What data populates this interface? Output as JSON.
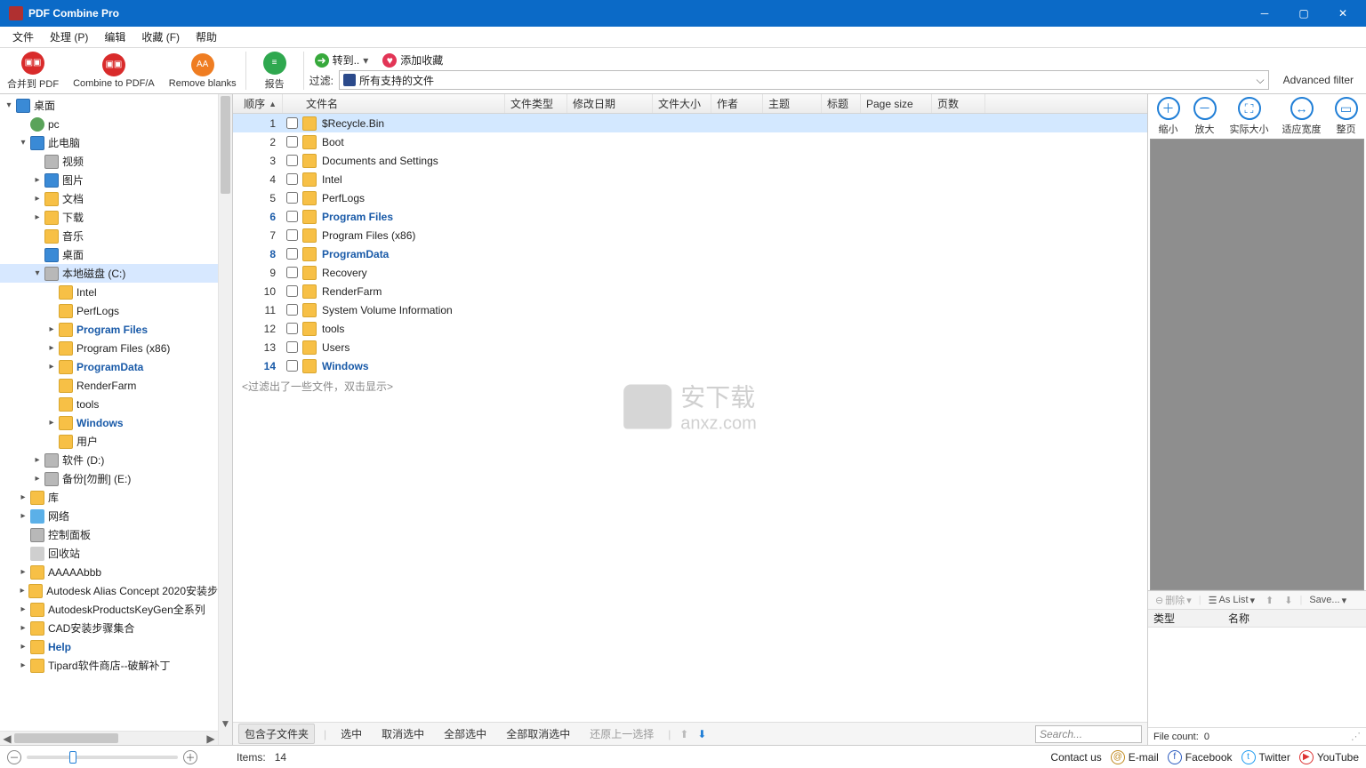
{
  "window": {
    "title": "PDF Combine Pro"
  },
  "menu": [
    "文件",
    "处理 (P)",
    "编辑",
    "收藏 (F)",
    "帮助"
  ],
  "toolbar": {
    "combine_pdf": "合并到 PDF",
    "combine_pdfa": "Combine to PDF/A",
    "remove_blanks": "Remove blanks",
    "report": "报告",
    "goto": "转到..",
    "add_fav": "添加收藏",
    "filter_label": "过滤:",
    "filter_value": "所有支持的文件",
    "adv_filter": "Advanced filter"
  },
  "tree": [
    {
      "d": 0,
      "c": "down",
      "ico": "nscreen",
      "t": "桌面"
    },
    {
      "d": 1,
      "c": "blank",
      "ico": "nuser",
      "t": "pc"
    },
    {
      "d": 1,
      "c": "down",
      "ico": "nscreen",
      "t": "此电脑"
    },
    {
      "d": 2,
      "c": "blank",
      "ico": "ndisk",
      "t": "视频"
    },
    {
      "d": 2,
      "c": "right",
      "ico": "nscreen",
      "t": "图片"
    },
    {
      "d": 2,
      "c": "right",
      "ico": "nfolder",
      "t": "文档"
    },
    {
      "d": 2,
      "c": "right",
      "ico": "nfolder",
      "t": "下载"
    },
    {
      "d": 2,
      "c": "blank",
      "ico": "nfolder",
      "t": "音乐"
    },
    {
      "d": 2,
      "c": "blank",
      "ico": "nscreen",
      "t": "桌面"
    },
    {
      "d": 2,
      "c": "down",
      "ico": "ndisk",
      "t": "本地磁盘 (C:)",
      "sel": true
    },
    {
      "d": 3,
      "c": "blank",
      "ico": "nfolder",
      "t": "Intel"
    },
    {
      "d": 3,
      "c": "blank",
      "ico": "nfolder",
      "t": "PerfLogs"
    },
    {
      "d": 3,
      "c": "right",
      "ico": "nfolder",
      "t": "Program Files",
      "b": true
    },
    {
      "d": 3,
      "c": "right",
      "ico": "nfolder",
      "t": "Program Files (x86)"
    },
    {
      "d": 3,
      "c": "right",
      "ico": "nfolder",
      "t": "ProgramData",
      "b": true
    },
    {
      "d": 3,
      "c": "blank",
      "ico": "nfolder",
      "t": "RenderFarm"
    },
    {
      "d": 3,
      "c": "blank",
      "ico": "nfolder",
      "t": "tools"
    },
    {
      "d": 3,
      "c": "right",
      "ico": "nfolder",
      "t": "Windows",
      "b": true
    },
    {
      "d": 3,
      "c": "blank",
      "ico": "nfolder",
      "t": "用户"
    },
    {
      "d": 2,
      "c": "right",
      "ico": "ndisk",
      "t": "软件 (D:)"
    },
    {
      "d": 2,
      "c": "right",
      "ico": "ndisk",
      "t": "备份[勿删] (E:)"
    },
    {
      "d": 1,
      "c": "right",
      "ico": "nfolder",
      "t": "库"
    },
    {
      "d": 1,
      "c": "right",
      "ico": "nnet",
      "t": "网络"
    },
    {
      "d": 1,
      "c": "blank",
      "ico": "ndisk",
      "t": "控制面板"
    },
    {
      "d": 1,
      "c": "blank",
      "ico": "nbin",
      "t": "回收站"
    },
    {
      "d": 1,
      "c": "right",
      "ico": "nfolder",
      "t": "AAAAAbbb"
    },
    {
      "d": 1,
      "c": "right",
      "ico": "nfolder",
      "t": "Autodesk Alias Concept 2020安装步"
    },
    {
      "d": 1,
      "c": "right",
      "ico": "nfolder",
      "t": "AutodeskProductsKeyGen全系列"
    },
    {
      "d": 1,
      "c": "right",
      "ico": "nfolder",
      "t": "CAD安装步骤集合"
    },
    {
      "d": 1,
      "c": "right",
      "ico": "nfolder",
      "t": "Help",
      "b": true
    },
    {
      "d": 1,
      "c": "right",
      "ico": "nfolder",
      "t": "Tipard软件商店--破解补丁"
    }
  ],
  "columns": {
    "seq": "顺序",
    "name": "文件名",
    "type": "文件类型",
    "date": "修改日期",
    "size": "文件大小",
    "author": "作者",
    "subject": "主题",
    "title": "标题",
    "pagesize": "Page size",
    "pages": "页数"
  },
  "files": [
    {
      "n": 1,
      "name": "$Recycle.Bin",
      "sel": true
    },
    {
      "n": 2,
      "name": "Boot"
    },
    {
      "n": 3,
      "name": "Documents and Settings"
    },
    {
      "n": 4,
      "name": "Intel"
    },
    {
      "n": 5,
      "name": "PerfLogs"
    },
    {
      "n": 6,
      "name": "Program Files",
      "b": true
    },
    {
      "n": 7,
      "name": "Program Files (x86)"
    },
    {
      "n": 8,
      "name": "ProgramData",
      "b": true
    },
    {
      "n": 9,
      "name": "Recovery"
    },
    {
      "n": 10,
      "name": "RenderFarm"
    },
    {
      "n": 11,
      "name": "System Volume Information"
    },
    {
      "n": 12,
      "name": "tools"
    },
    {
      "n": 13,
      "name": "Users"
    },
    {
      "n": 14,
      "name": "Windows",
      "b": true
    }
  ],
  "filter_hint": "<过滤出了一些文件，双击显示>",
  "watermark": {
    "line1": "安下载",
    "line2": "anxz.com"
  },
  "actions": {
    "include_sub": "包含子文件夹",
    "check": "选中",
    "uncheck": "取消选中",
    "check_all": "全部选中",
    "uncheck_all": "全部取消选中",
    "restore": "还原上一选择",
    "search_ph": "Search..."
  },
  "right": {
    "zoom_out": "缩小",
    "zoom_in": "放大",
    "actual": "实际大小",
    "fit_w": "适应宽度",
    "whole": "整页",
    "delete": "删除",
    "aslist": "As List",
    "save": "Save...",
    "col_type": "类型",
    "col_name": "名称",
    "filecount_lbl": "File count:",
    "filecount_val": "0"
  },
  "status": {
    "items_lbl": "Items:",
    "items_val": "14",
    "contact": "Contact us",
    "email": "E-mail",
    "fb": "Facebook",
    "tw": "Twitter",
    "yt": "YouTube"
  }
}
